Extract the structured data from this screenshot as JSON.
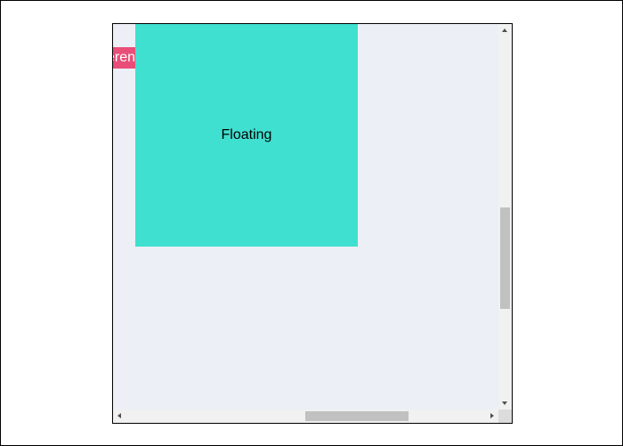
{
  "scroll_container": {
    "reference_label": "eren",
    "floating_label": "Floating",
    "colors": {
      "background": "#eceff5",
      "reference": "#e84e78",
      "floating": "#40e0d0"
    },
    "vertical_scroll_fraction": 0.47,
    "horizontal_scroll_fraction": 0.5
  }
}
